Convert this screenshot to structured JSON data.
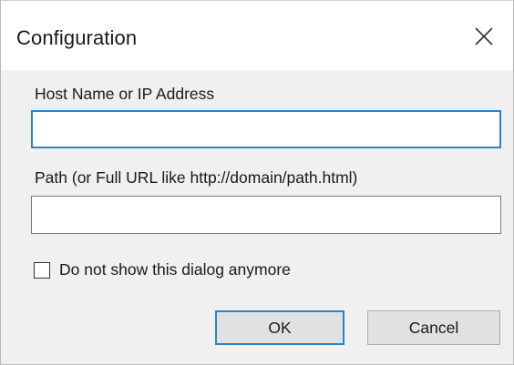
{
  "window": {
    "title": "Configuration",
    "close_icon": "close-icon"
  },
  "form": {
    "host_label": "Host Name or IP Address",
    "host_value": "",
    "path_label": "Path (or Full URL like http://domain/path.html)",
    "path_value": "",
    "dont_show_label": "Do not show this dialog anymore",
    "dont_show_checked": false
  },
  "buttons": {
    "ok_label": "OK",
    "cancel_label": "Cancel"
  },
  "colors": {
    "focus_accent": "#2f80c8",
    "dialog_body": "#f0f0f0",
    "button_face": "#e1e1e1"
  }
}
